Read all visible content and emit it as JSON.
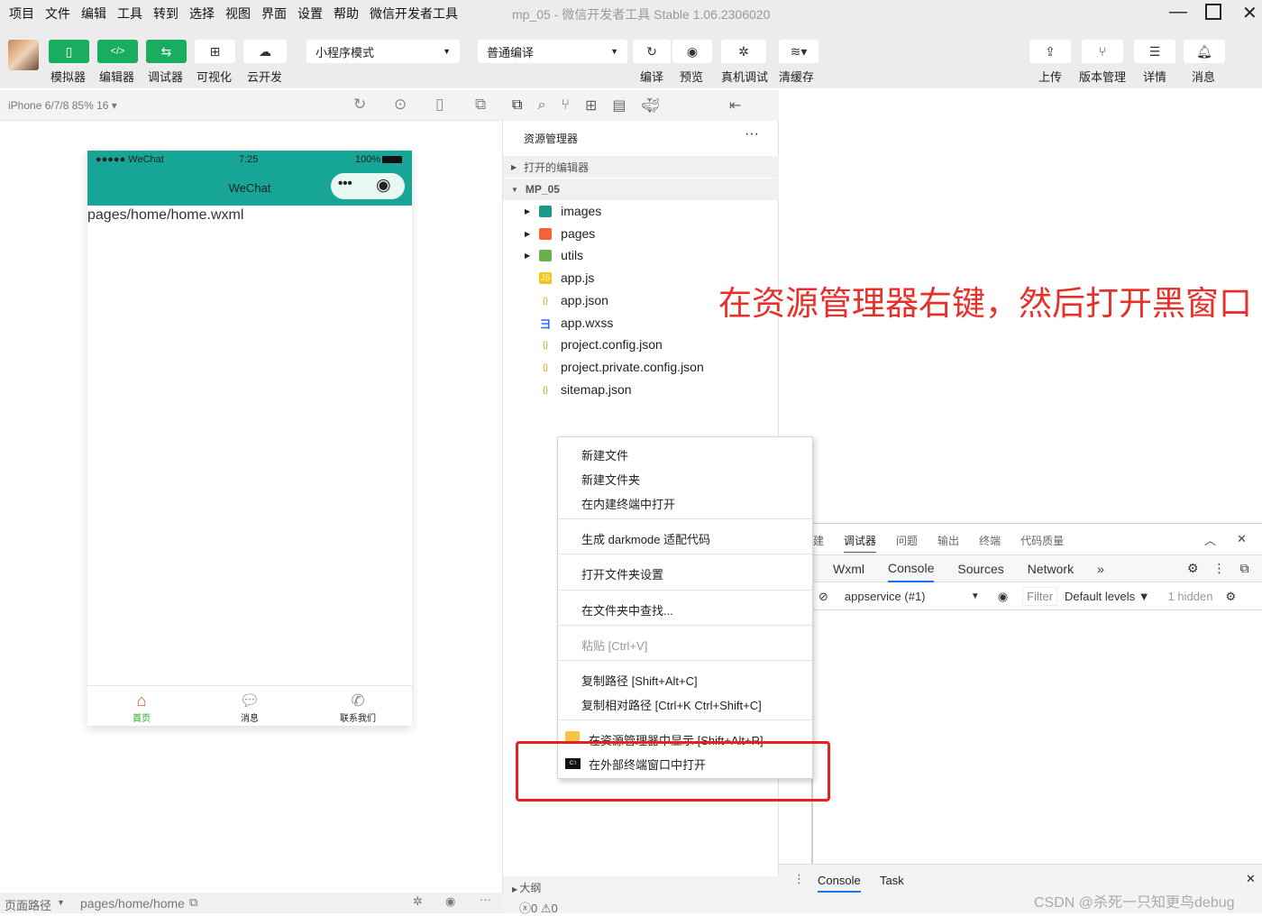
{
  "menu": [
    "项目",
    "文件",
    "编辑",
    "工具",
    "转到",
    "选择",
    "视图",
    "界面",
    "设置",
    "帮助",
    "微信开发者工具"
  ],
  "window_title": "mp_05 - 微信开发者工具 Stable 1.06.2306020",
  "toolbar": {
    "left": [
      {
        "label": "模拟器",
        "icon": "phone-icon"
      },
      {
        "label": "编辑器",
        "icon": "code-icon"
      },
      {
        "label": "调试器",
        "icon": "debug-toggle-icon"
      },
      {
        "label": "可视化",
        "icon": "layout-icon"
      },
      {
        "label": "云开发",
        "icon": "cloud-icon"
      }
    ],
    "mode_select": "小程序模式",
    "compile_select": "普通编译",
    "mid": [
      {
        "label": "编译",
        "icon": "refresh-icon"
      },
      {
        "label": "预览",
        "icon": "eye-icon"
      },
      {
        "label": "真机调试",
        "icon": "bug-icon"
      },
      {
        "label": "清缓存",
        "icon": "layers-icon"
      }
    ],
    "right": [
      {
        "label": "上传",
        "icon": "upload-icon"
      },
      {
        "label": "版本管理",
        "icon": "branch-icon"
      },
      {
        "label": "详情",
        "icon": "menu-icon"
      },
      {
        "label": "消息",
        "icon": "bell-icon"
      }
    ]
  },
  "simulator": {
    "device": "iPhone 6/7/8 85% 16 ▾",
    "status_left": "●●●●● WeChat",
    "time": "7:25",
    "battery": "100%",
    "nav_title": "WeChat",
    "content": "pages/home/home.wxml",
    "tabs": [
      {
        "label": "首页",
        "active": true
      },
      {
        "label": "消息"
      },
      {
        "label": "联系我们"
      }
    ],
    "path_label": "页面路径",
    "path": "pages/home/home"
  },
  "explorer": {
    "title": "资源管理器",
    "open_editors": "打开的编辑器",
    "project": "MP_05",
    "items": [
      {
        "name": "images",
        "type": "folder",
        "color": "#1a9a8a"
      },
      {
        "name": "pages",
        "type": "folder",
        "color": "#f0643c"
      },
      {
        "name": "utils",
        "type": "folder",
        "color": "#6ab04c"
      },
      {
        "name": "app.js",
        "type": "js"
      },
      {
        "name": "app.json",
        "type": "json"
      },
      {
        "name": "app.wxss",
        "type": "wxss"
      },
      {
        "name": "project.config.json",
        "type": "json"
      },
      {
        "name": "project.private.config.json",
        "type": "json"
      },
      {
        "name": "sitemap.json",
        "type": "json"
      }
    ],
    "outline": "大纲",
    "errors": "0",
    "warnings": "0"
  },
  "context_menu": [
    "新建文件",
    "新建文件夹",
    "在内建终端中打开",
    "生成 darkmode 适配代码",
    "打开文件夹设置",
    "在文件夹中查找...",
    "粘贴  [Ctrl+V]",
    "复制路径  [Shift+Alt+C]",
    "复制相对路径  [Ctrl+K Ctrl+Shift+C]",
    "在资源管理器中显示  [Shift+Alt+R]",
    "在外部终端窗口中打开"
  ],
  "annotation": "在资源管理器右键，然后打开黑窗口",
  "devtools": {
    "top_tabs": [
      "建",
      "调试器",
      "问题",
      "输出",
      "终端",
      "代码质量"
    ],
    "tabs": [
      "Wxml",
      "Console",
      "Sources",
      "Network",
      "»"
    ],
    "context": "appservice (#1)",
    "filter": "Filter",
    "levels": "Default levels ▼",
    "hidden": "1 hidden"
  },
  "drawer": {
    "tabs": [
      "Console",
      "Task"
    ]
  },
  "watermark": "CSDN @杀死一只知更鸟debug",
  "colors": {
    "accent": "#1aad5f",
    "nav": "#16a596",
    "annotation": "#e8302a"
  }
}
